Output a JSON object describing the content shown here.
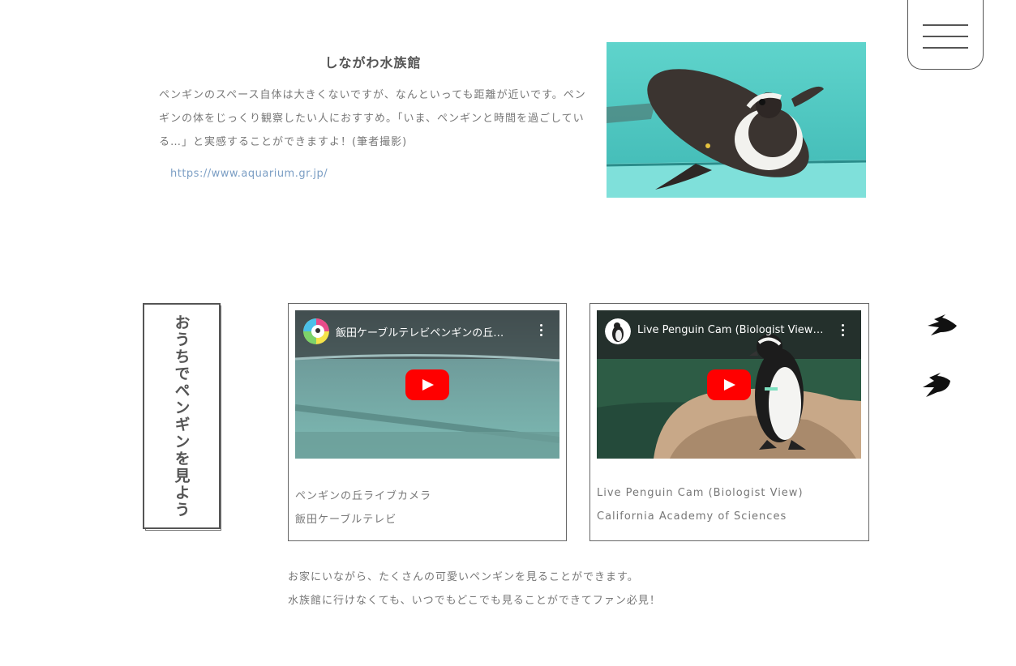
{
  "aquarium": {
    "title": "しながわ水族館",
    "description": "ペンギンのスペース自体は大きくないですが、なんといっても距離が近いです。ペンギンの体をじっくり観察したい人におすすめ。「いま、ペンギンと時間を過ごしている…」と実感することができますよ！(筆者撮影)",
    "link": "https://www.aquarium.gr.jp/"
  },
  "section": {
    "title": "おうちでペンギンを見よう"
  },
  "videos": [
    {
      "title": "飯田ケーブルテレビペンギンの丘…",
      "caption_title": "ペンギンの丘ライブカメラ",
      "caption_channel": "飯田ケーブルテレビ"
    },
    {
      "title": "Live Penguin Cam (Biologist View…",
      "caption_title": "Live Penguin Cam (Biologist View)",
      "caption_channel": "California Academy of Sciences"
    }
  ],
  "bottom": {
    "line1": "お家にいながら、たくさんの可愛いペンギンを見ることができます。",
    "line2": "水族館に行けなくても、いつでもどこでも見ることができてファン必見！"
  },
  "icons": {
    "menu": "hamburger-icon",
    "play": "play-icon",
    "more": "more-vertical-icon",
    "footprint": "penguin-footprint-icon"
  },
  "colors": {
    "accent_link": "#7b9ec4",
    "play_button": "#ff0000"
  }
}
